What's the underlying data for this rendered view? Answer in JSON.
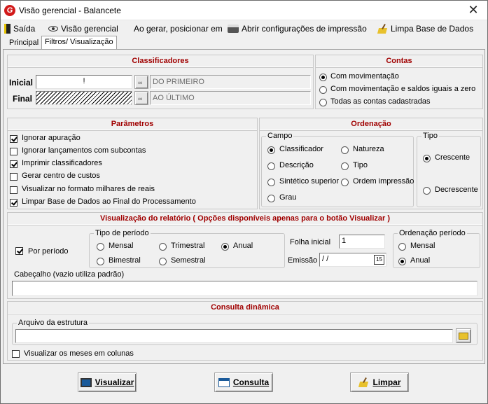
{
  "window": {
    "title": "Visão gerencial - Balancete",
    "close": "✕"
  },
  "toolbar": {
    "exit": "Saída",
    "view": "Visão gerencial",
    "position_label": "Ao gerar, posicionar em",
    "print_config": "Abrir configurações de impressão",
    "clean_db": "Limpa Base de Dados"
  },
  "tabs": [
    "Principal",
    "Filtros/ Visualização"
  ],
  "classificadores": {
    "title": "Classificadores",
    "inicial_label": "Inicial",
    "inicial_value": "!",
    "inicial_desc": "DO PRIMEIRO",
    "final_label": "Final",
    "final_desc": "AO ÚLTIMO"
  },
  "contas": {
    "title": "Contas",
    "options": [
      "Com movimentação",
      "Com movimentação e saldos iguais a zero",
      "Todas as contas cadastradas"
    ],
    "selected": 0
  },
  "parametros": {
    "title": "Parâmetros",
    "items": [
      {
        "label": "Ignorar apuração",
        "checked": true
      },
      {
        "label": "Ignorar lançamentos com subcontas",
        "checked": false
      },
      {
        "label": "Imprimir classificadores",
        "checked": true
      },
      {
        "label": "Gerar centro de custos",
        "checked": false
      },
      {
        "label": "Visualizar no formato milhares de reais",
        "checked": false
      },
      {
        "label": "Limpar Base de Dados ao Final do Processamento",
        "checked": true
      }
    ]
  },
  "ordenacao": {
    "title": "Ordenação",
    "campo_legend": "Campo",
    "campo": [
      "Classificador",
      "Natureza",
      "Descrição",
      "Tipo",
      "Sintético superior",
      "Ordem impressão",
      "Grau"
    ],
    "campo_selected": 0,
    "tipo_legend": "Tipo",
    "tipo": [
      "Crescente",
      "Decrescente"
    ],
    "tipo_selected": 0
  },
  "visualizacao": {
    "title": "Visualização do relatório ( Opções disponíveis apenas para o botão Visualizar )",
    "por_periodo": "Por período",
    "por_periodo_checked": true,
    "tipo_periodo_legend": "Tipo de período",
    "tipo_periodo": [
      "Mensal",
      "Trimestral",
      "Anual",
      "Bimestral",
      "Semestral"
    ],
    "tipo_periodo_selected": 2,
    "folha_inicial_label": "Folha inicial",
    "folha_inicial_value": "1",
    "emissao_label": "Emissão",
    "emissao_value": " /  /",
    "calendar": "15",
    "ord_periodo_legend": "Ordenação período",
    "ord_periodo": [
      "Mensal",
      "Anual"
    ],
    "ord_periodo_selected": 1,
    "cabecalho_legend": "Cabeçalho (vazio utiliza padrão)",
    "cabecalho_value": ""
  },
  "consulta": {
    "title": "Consulta dinâmica",
    "arquivo_legend": "Arquivo da estrutura",
    "arquivo_value": "",
    "meses_label": "Visualizar os meses em colunas",
    "meses_checked": false
  },
  "buttons": {
    "visualizar": "Visualizar",
    "consulta": "Consulta",
    "limpar": "Limpar"
  }
}
